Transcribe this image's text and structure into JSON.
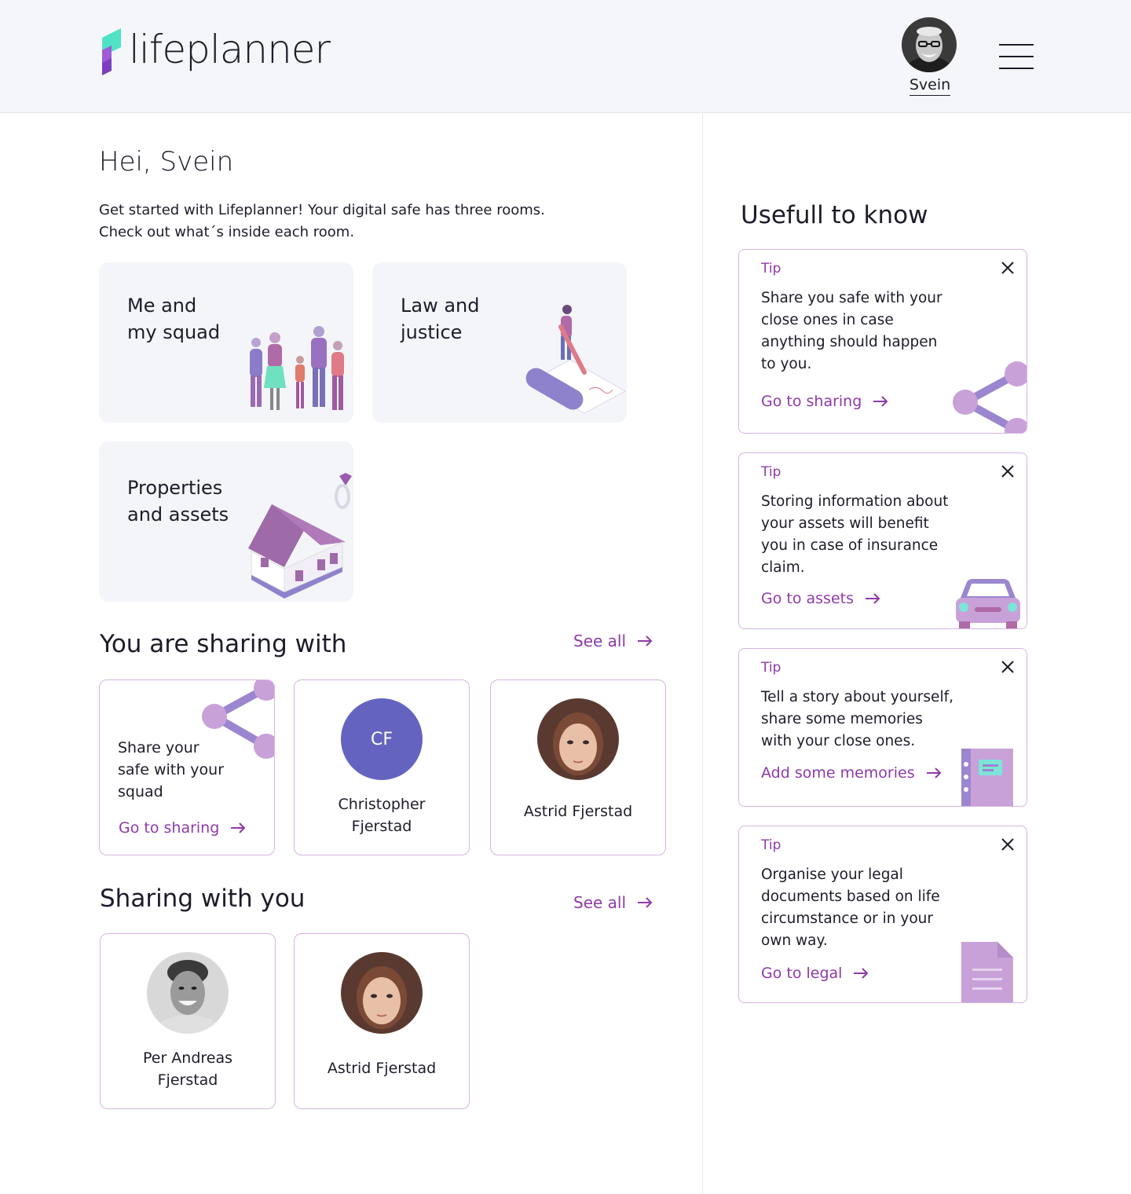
{
  "app": {
    "logo_text": "lifeplanner",
    "user_name": "Svein"
  },
  "greeting": "Hei, Svein",
  "intro": {
    "line1": "Get started with Lifeplanner! Your digital safe has three rooms.",
    "line2": "Check out what´s inside each room."
  },
  "rooms": [
    {
      "line1": "Me and",
      "line2": "my squad"
    },
    {
      "line1": "Law and",
      "line2": "justice"
    },
    {
      "line1": "Properties",
      "line2": "and assets"
    }
  ],
  "sharing_with": {
    "title": "You are sharing with",
    "see_all": "See all",
    "share_card": {
      "line1": "Share your",
      "line2": "safe with your",
      "line3": "squad",
      "link": "Go to sharing"
    },
    "people": [
      {
        "initials": "CF",
        "line1": "Christopher",
        "line2": "Fjerstad"
      },
      {
        "line1": "Astrid Fjerstad"
      }
    ]
  },
  "sharing_with_you": {
    "title": "Sharing with you",
    "see_all": "See all",
    "people": [
      {
        "line1": "Per Andreas",
        "line2": "Fjerstad"
      },
      {
        "line1": "Astrid Fjerstad"
      }
    ]
  },
  "useful": {
    "title": "Usefull to know",
    "tips": [
      {
        "label": "Tip",
        "lines": [
          "Share you safe with your",
          "close ones in case",
          "anything should happen",
          "to you."
        ],
        "link": "Go to sharing"
      },
      {
        "label": "Tip",
        "lines": [
          "Storing information about",
          "your assets will benefit",
          "you in case of insurance",
          "claim."
        ],
        "link": "Go to assets"
      },
      {
        "label": "Tip",
        "lines": [
          "Tell a story about yourself,",
          "share some memories",
          "with your close ones."
        ],
        "link": "Add some memories"
      },
      {
        "label": "Tip",
        "lines": [
          "Organise your legal",
          "documents based on life",
          "circumstance or in your",
          "own way."
        ],
        "link": "Go to legal"
      }
    ]
  },
  "colors": {
    "accent": "#8e3aa8",
    "card_border": "#d7b4e2",
    "room_bg": "#f4f5f9",
    "header_bg": "#f5f6f9",
    "initials_bg": "#6464c0",
    "illustration_lilac": "#c9a1d9"
  },
  "icons": [
    "close-icon",
    "arrow-right-icon",
    "share-icon",
    "car-icon",
    "notebook-icon",
    "document-icon",
    "menu-icon"
  ]
}
